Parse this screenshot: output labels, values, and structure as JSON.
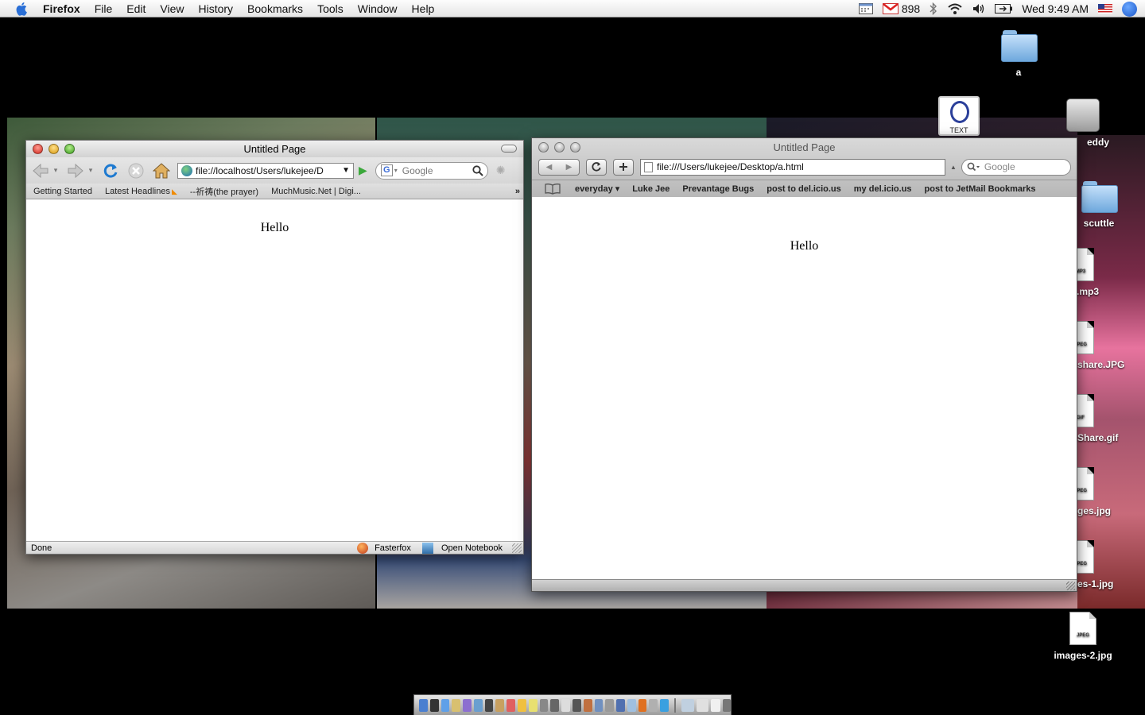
{
  "menubar": {
    "app": "Firefox",
    "items": [
      "File",
      "Edit",
      "View",
      "History",
      "Bookmarks",
      "Tools",
      "Window",
      "Help"
    ],
    "mail_count": "898",
    "clock": "Wed 9:49 AM"
  },
  "desktop": {
    "icons": [
      {
        "label": "a",
        "kind": "folder-icon"
      },
      {
        "label": "eddy",
        "kind": "disk-icon"
      },
      {
        "label": "scuttle",
        "kind": "folder-icon"
      },
      {
        "label": ".mp3",
        "kind": "mp3-file-icon",
        "badge": "MP3"
      },
      {
        "label": "share.JPG",
        "kind": "jpeg-file-icon",
        "badge": "JPEG"
      },
      {
        "label": "Share.gif",
        "kind": "gif-file-icon",
        "badge": "GIF"
      },
      {
        "label": "ges.jpg",
        "kind": "jpeg-file-icon",
        "badge": "JPEG"
      },
      {
        "label": "es-1.jpg",
        "kind": "jpeg-file-icon",
        "badge": "JPEG"
      },
      {
        "label": "images-2.jpg",
        "kind": "jpeg-file-icon",
        "badge": "JPEG"
      }
    ],
    "text_icon_label": "TEXT"
  },
  "firefox": {
    "title": "Untitled Page",
    "url": "file://localhost/Users/lukejee/D",
    "search_placeholder": "Google",
    "bookmarks": [
      "Getting Started",
      "Latest Headlines",
      "--祈祷(the prayer)",
      "MuchMusic.Net | Digi..."
    ],
    "more": "»",
    "content_text": "Hello",
    "status": "Done",
    "status_items": [
      "Fasterfox",
      "Open Notebook"
    ]
  },
  "safari": {
    "title": "Untitled Page",
    "url": "file:///Users/lukejee/Desktop/a.html",
    "search_placeholder": "Google",
    "bookmarks": [
      "everyday ▾",
      "Luke Jee",
      "Prevantage Bugs",
      "post to del.icio.us",
      "my del.icio.us",
      "post to JetMail Bookmarks"
    ],
    "content_text": "Hello"
  },
  "colors": {
    "desktop_bg": "#000000",
    "accent_blue": "#1e7ad0"
  }
}
